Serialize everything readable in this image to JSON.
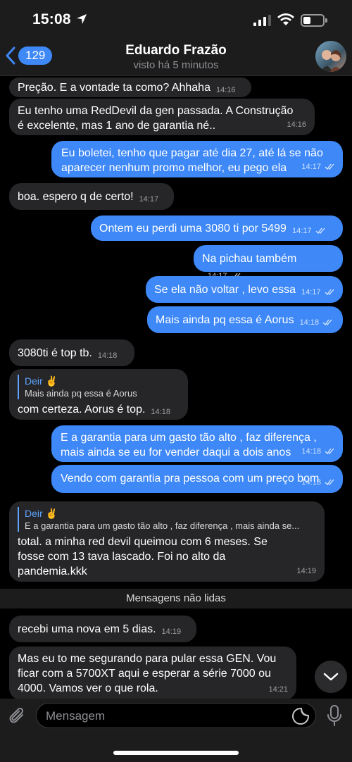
{
  "status": {
    "time": "15:08"
  },
  "header": {
    "back_count": "129",
    "title": "Eduardo Frazão",
    "subtitle": "visto há 5 minutos"
  },
  "messages": [
    {
      "dir": "in",
      "text": "Preção. E a vontade ta como? Ahhaha",
      "time": "14:16"
    },
    {
      "dir": "in",
      "text_lines": [
        "Eu tenho uma RedDevil da gen passada. A Construção",
        "é excelente, mas 1 ano de garantia né.."
      ],
      "time": "14:16"
    },
    {
      "dir": "out",
      "text_lines": [
        "Eu boletei, tenho que pagar até dia 27, até lá se não",
        "aparecer nenhum promo melhor, eu pego ela"
      ],
      "time": "14:17"
    },
    {
      "dir": "in",
      "text": "boa. espero q de certo!",
      "time": "14:17"
    },
    {
      "dir": "out",
      "text": "Ontem eu perdi uma 3080 ti por 5499",
      "time": "14:17"
    },
    {
      "dir": "out",
      "text": "Na pichau também",
      "time": "14:17"
    },
    {
      "dir": "out",
      "text": "Se ela não voltar , levo essa",
      "time": "14:17"
    },
    {
      "dir": "out",
      "text": "Mais ainda pq essa é Aorus",
      "time": "14:18"
    },
    {
      "dir": "in",
      "text": "3080ti é top tb.",
      "time": "14:18"
    },
    {
      "dir": "in",
      "reply_name": "Deir ✌️",
      "reply_text": "Mais ainda pq essa é Aorus",
      "text": "com certeza. Aorus é top.",
      "time": "14:18"
    },
    {
      "dir": "out",
      "text_lines": [
        "E a garantia para um gasto tão alto , faz diferença ,",
        "mais ainda se eu for vender daqui a dois anos"
      ],
      "time": "14:18"
    },
    {
      "dir": "out",
      "text": "Vendo com garantia pra pessoa com um preço bom",
      "time": "14:18"
    },
    {
      "dir": "in",
      "reply_name": "Deir ✌️",
      "reply_text": "E a garantia para um gasto tão alto , faz diferença , mais ainda se...",
      "text_lines": [
        "total. a minha red devil queimou com 6 meses. Se",
        "fosse com 13 tava lascado. Foi no alto da",
        "pandemia.kkk"
      ],
      "time": "14:19"
    },
    {
      "dir": "in",
      "text": "recebi uma nova em 5 dias.",
      "time": "14:19"
    },
    {
      "dir": "in",
      "text_lines": [
        "Mas eu to me segurando para pular essa GEN. Vou",
        "ficar com a 5700XT aqui e esperar a série 7000 ou",
        "4000. Vamos ver o que rola."
      ],
      "time": "14:21"
    }
  ],
  "unread_label": "Mensagens não lidas",
  "input": {
    "placeholder": "Mensagem"
  },
  "colors": {
    "outgoing": "#3e88f7",
    "incoming": "#262628",
    "accent": "#5ea4ff"
  },
  "icons": [
    "location-arrow-icon",
    "signal-icon",
    "wifi-icon",
    "battery-icon",
    "back-chevron-icon",
    "attach-icon",
    "sticker-icon",
    "mic-icon",
    "chevron-down-icon"
  ]
}
